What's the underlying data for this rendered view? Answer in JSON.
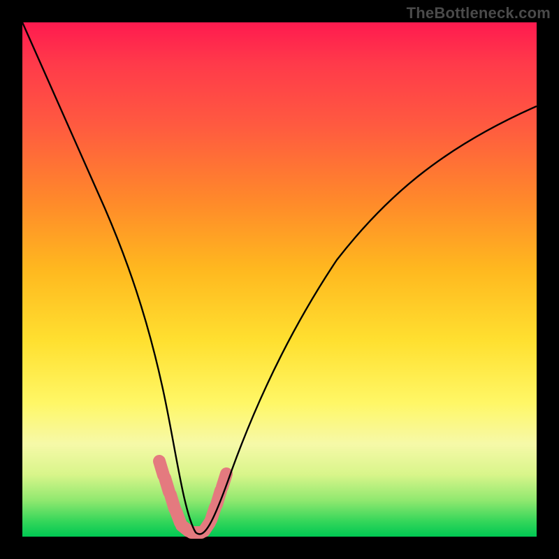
{
  "watermark": "TheBottleneck.com",
  "chart_data": {
    "type": "line",
    "title": "",
    "xlabel": "",
    "ylabel": "",
    "xlim": [
      0,
      100
    ],
    "ylim": [
      0,
      100
    ],
    "series": [
      {
        "name": "bottleneck-curve",
        "x": [
          0,
          4,
          8,
          12,
          16,
          20,
          24,
          26,
          28,
          30,
          32,
          34,
          36,
          40,
          46,
          54,
          62,
          70,
          80,
          90,
          100
        ],
        "values": [
          100,
          88,
          76,
          64,
          52,
          40,
          28,
          20,
          12,
          5,
          1,
          0,
          1,
          6,
          18,
          34,
          48,
          58,
          70,
          78,
          84
        ]
      }
    ],
    "annotations": [
      {
        "name": "highlight-trough",
        "type": "marker-band",
        "color": "#e47a7f",
        "points_x": [
          26.5,
          27.5,
          28.5,
          29.5,
          30.5,
          31.5,
          32.5,
          33.5,
          34.5,
          35.5,
          36.5
        ],
        "points_y": [
          15.0,
          10.0,
          6.0,
          3.0,
          1.0,
          0.5,
          0.5,
          1.0,
          3.0,
          7.0,
          13.0
        ]
      }
    ],
    "background_gradient": {
      "top": "#ff1a4f",
      "mid": "#ffe030",
      "bottom": "#00c853"
    }
  }
}
